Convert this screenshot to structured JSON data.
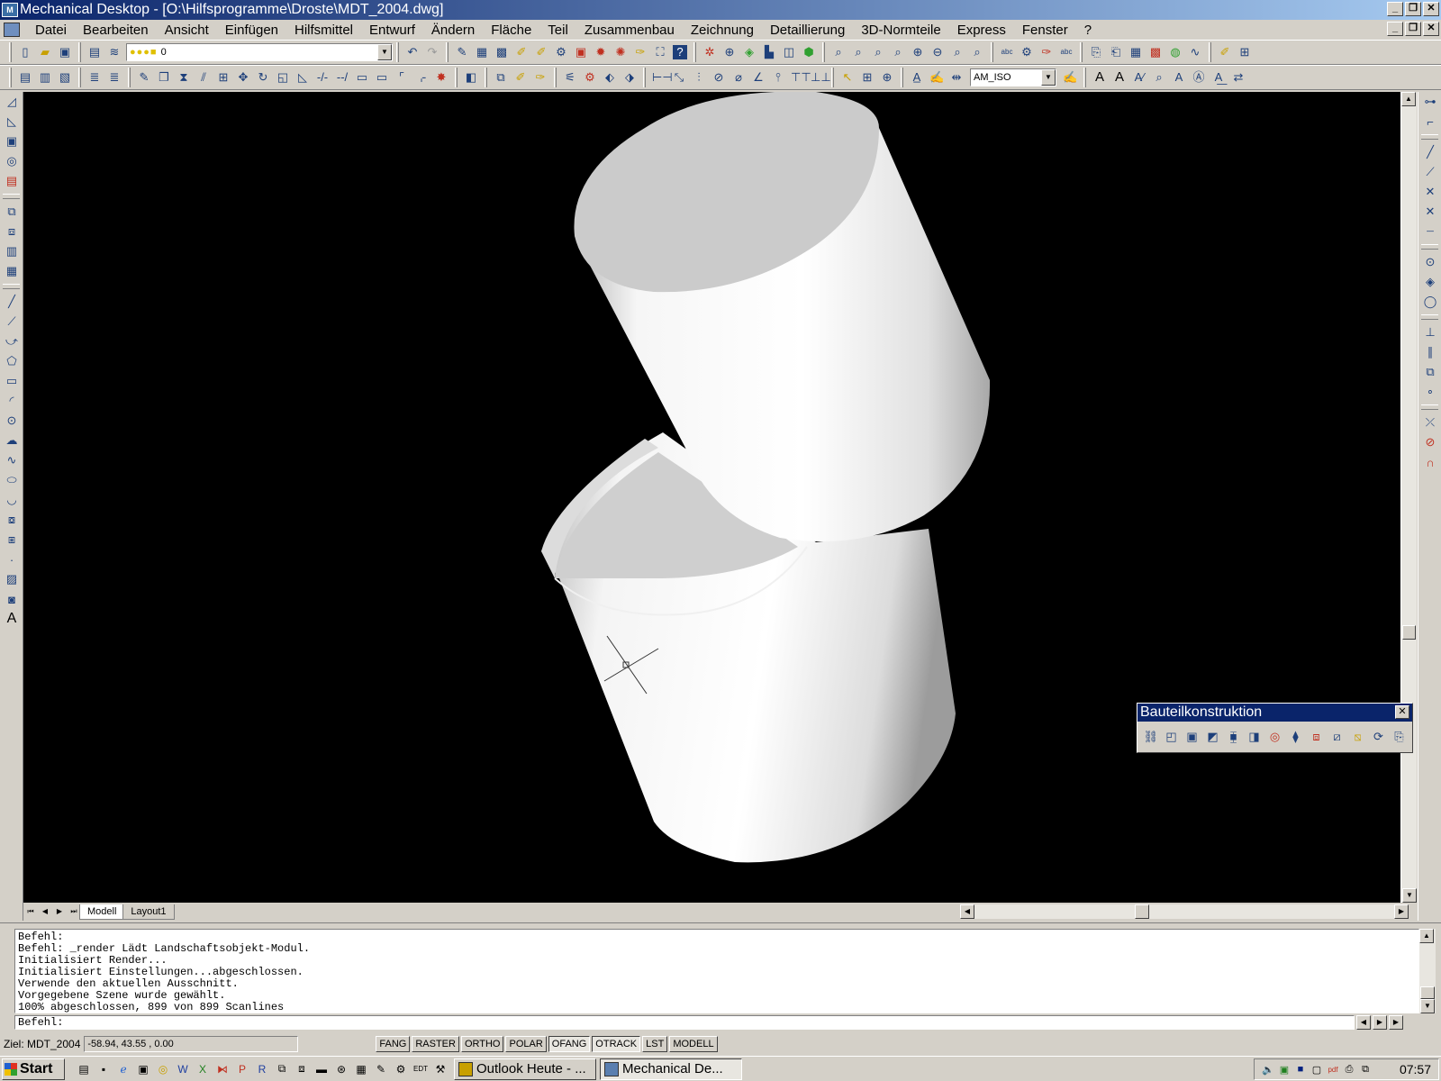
{
  "window": {
    "title": "Mechanical Desktop - [O:\\Hilfsprogramme\\Droste\\MDT_2004.dwg]",
    "controls": [
      "_",
      "❐",
      "✕"
    ]
  },
  "menu": [
    "Datei",
    "Bearbeiten",
    "Ansicht",
    "Einfügen",
    "Hilfsmittel",
    "Entwurf",
    "Ändern",
    "Fläche",
    "Teil",
    "Zusammenbau",
    "Zeichnung",
    "Detaillierung",
    "3D-Normteile",
    "Express",
    "Fenster",
    "?"
  ],
  "toolbar": {
    "layer_value": "0",
    "dimstyle_value": "AM_ISO"
  },
  "tabs": [
    "Modell",
    "Layout1"
  ],
  "palette": {
    "title": "Bauteilkonstruktion",
    "close": "✕"
  },
  "command": {
    "history": [
      "Befehl:",
      "Befehl: _render Lädt Landschaftsobjekt-Modul.",
      "Initialisiert Render...",
      "Initialisiert Einstellungen...abgeschlossen.",
      "Verwende den aktuellen Ausschnitt.",
      "Vorgegebene Szene wurde gewählt.",
      "100% abgeschlossen, 899 von 899 Scanlines"
    ],
    "prompt": "Befehl:"
  },
  "status": {
    "target": "Ziel: MDT_2004",
    "coords": "-58.94, 43.55 , 0.00",
    "modes": [
      {
        "label": "FANG",
        "on": false
      },
      {
        "label": "RASTER",
        "on": false
      },
      {
        "label": "ORTHO",
        "on": false
      },
      {
        "label": "POLAR",
        "on": false
      },
      {
        "label": "OFANG",
        "on": true
      },
      {
        "label": "OTRACK",
        "on": true
      },
      {
        "label": "LST",
        "on": false
      },
      {
        "label": "MODELL",
        "on": false
      }
    ]
  },
  "taskbar": {
    "start": "Start",
    "tasks": [
      {
        "label": "Outlook Heute - ...",
        "active": false
      },
      {
        "label": "Mechanical De...",
        "active": true
      }
    ],
    "clock": "07:57"
  }
}
